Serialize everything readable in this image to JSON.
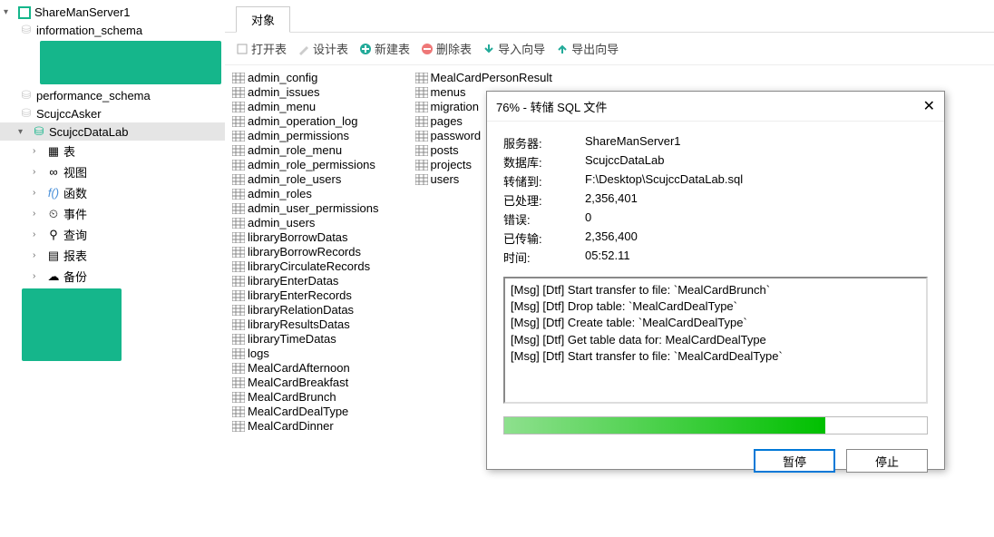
{
  "sidebar": {
    "server": "ShareManServer1",
    "dbs": [
      "information_schema",
      "performance_schema",
      "ScujccAsker",
      "ScujccDataLab"
    ],
    "children": [
      "表",
      "视图",
      "函数",
      "事件",
      "查询",
      "报表",
      "备份"
    ],
    "fn_icon": "f()"
  },
  "tab": {
    "label": "对象"
  },
  "toolbar": {
    "open": "打开表",
    "design": "设计表",
    "new": "新建表",
    "delete": "删除表",
    "import": "导入向导",
    "export": "导出向导"
  },
  "tables": {
    "col1": [
      "admin_config",
      "admin_issues",
      "admin_menu",
      "admin_operation_log",
      "admin_permissions",
      "admin_role_menu",
      "admin_role_permissions",
      "admin_role_users",
      "admin_roles",
      "admin_user_permissions",
      "admin_users",
      "libraryBorrowDatas",
      "libraryBorrowRecords",
      "libraryCirculateRecords",
      "libraryEnterDatas",
      "libraryEnterRecords",
      "libraryRelationDatas",
      "libraryResultsDatas",
      "libraryTimeDatas",
      "logs",
      "MealCardAfternoon",
      "MealCardBreakfast",
      "MealCardBrunch",
      "MealCardDealType",
      "MealCardDinner"
    ],
    "col2": [
      "MealCardPersonResult",
      "menus",
      "migration",
      "pages",
      "password",
      "posts",
      "projects",
      "users"
    ]
  },
  "dialog": {
    "title": "76% - 转储 SQL 文件",
    "rows": [
      {
        "label": "服务器:",
        "value": "ShareManServer1"
      },
      {
        "label": "数据库:",
        "value": "ScujccDataLab"
      },
      {
        "label": "转储到:",
        "value": "F:\\Desktop\\ScujccDataLab.sql"
      },
      {
        "label": "已处理:",
        "value": "2,356,401"
      },
      {
        "label": "错误:",
        "value": "0"
      },
      {
        "label": "已传输:",
        "value": "2,356,400"
      },
      {
        "label": "时间:",
        "value": "05:52.11"
      }
    ],
    "messages": [
      "[Msg] [Dtf] Start transfer to file: `MealCardBrunch`",
      "[Msg] [Dtf] Drop table: `MealCardDealType`",
      "[Msg] [Dtf] Create table: `MealCardDealType`",
      "[Msg] [Dtf] Get table data for: MealCardDealType",
      "[Msg] [Dtf] Start transfer to file: `MealCardDealType`"
    ],
    "progress_pct": 76,
    "pause": "暂停",
    "stop": "停止"
  }
}
